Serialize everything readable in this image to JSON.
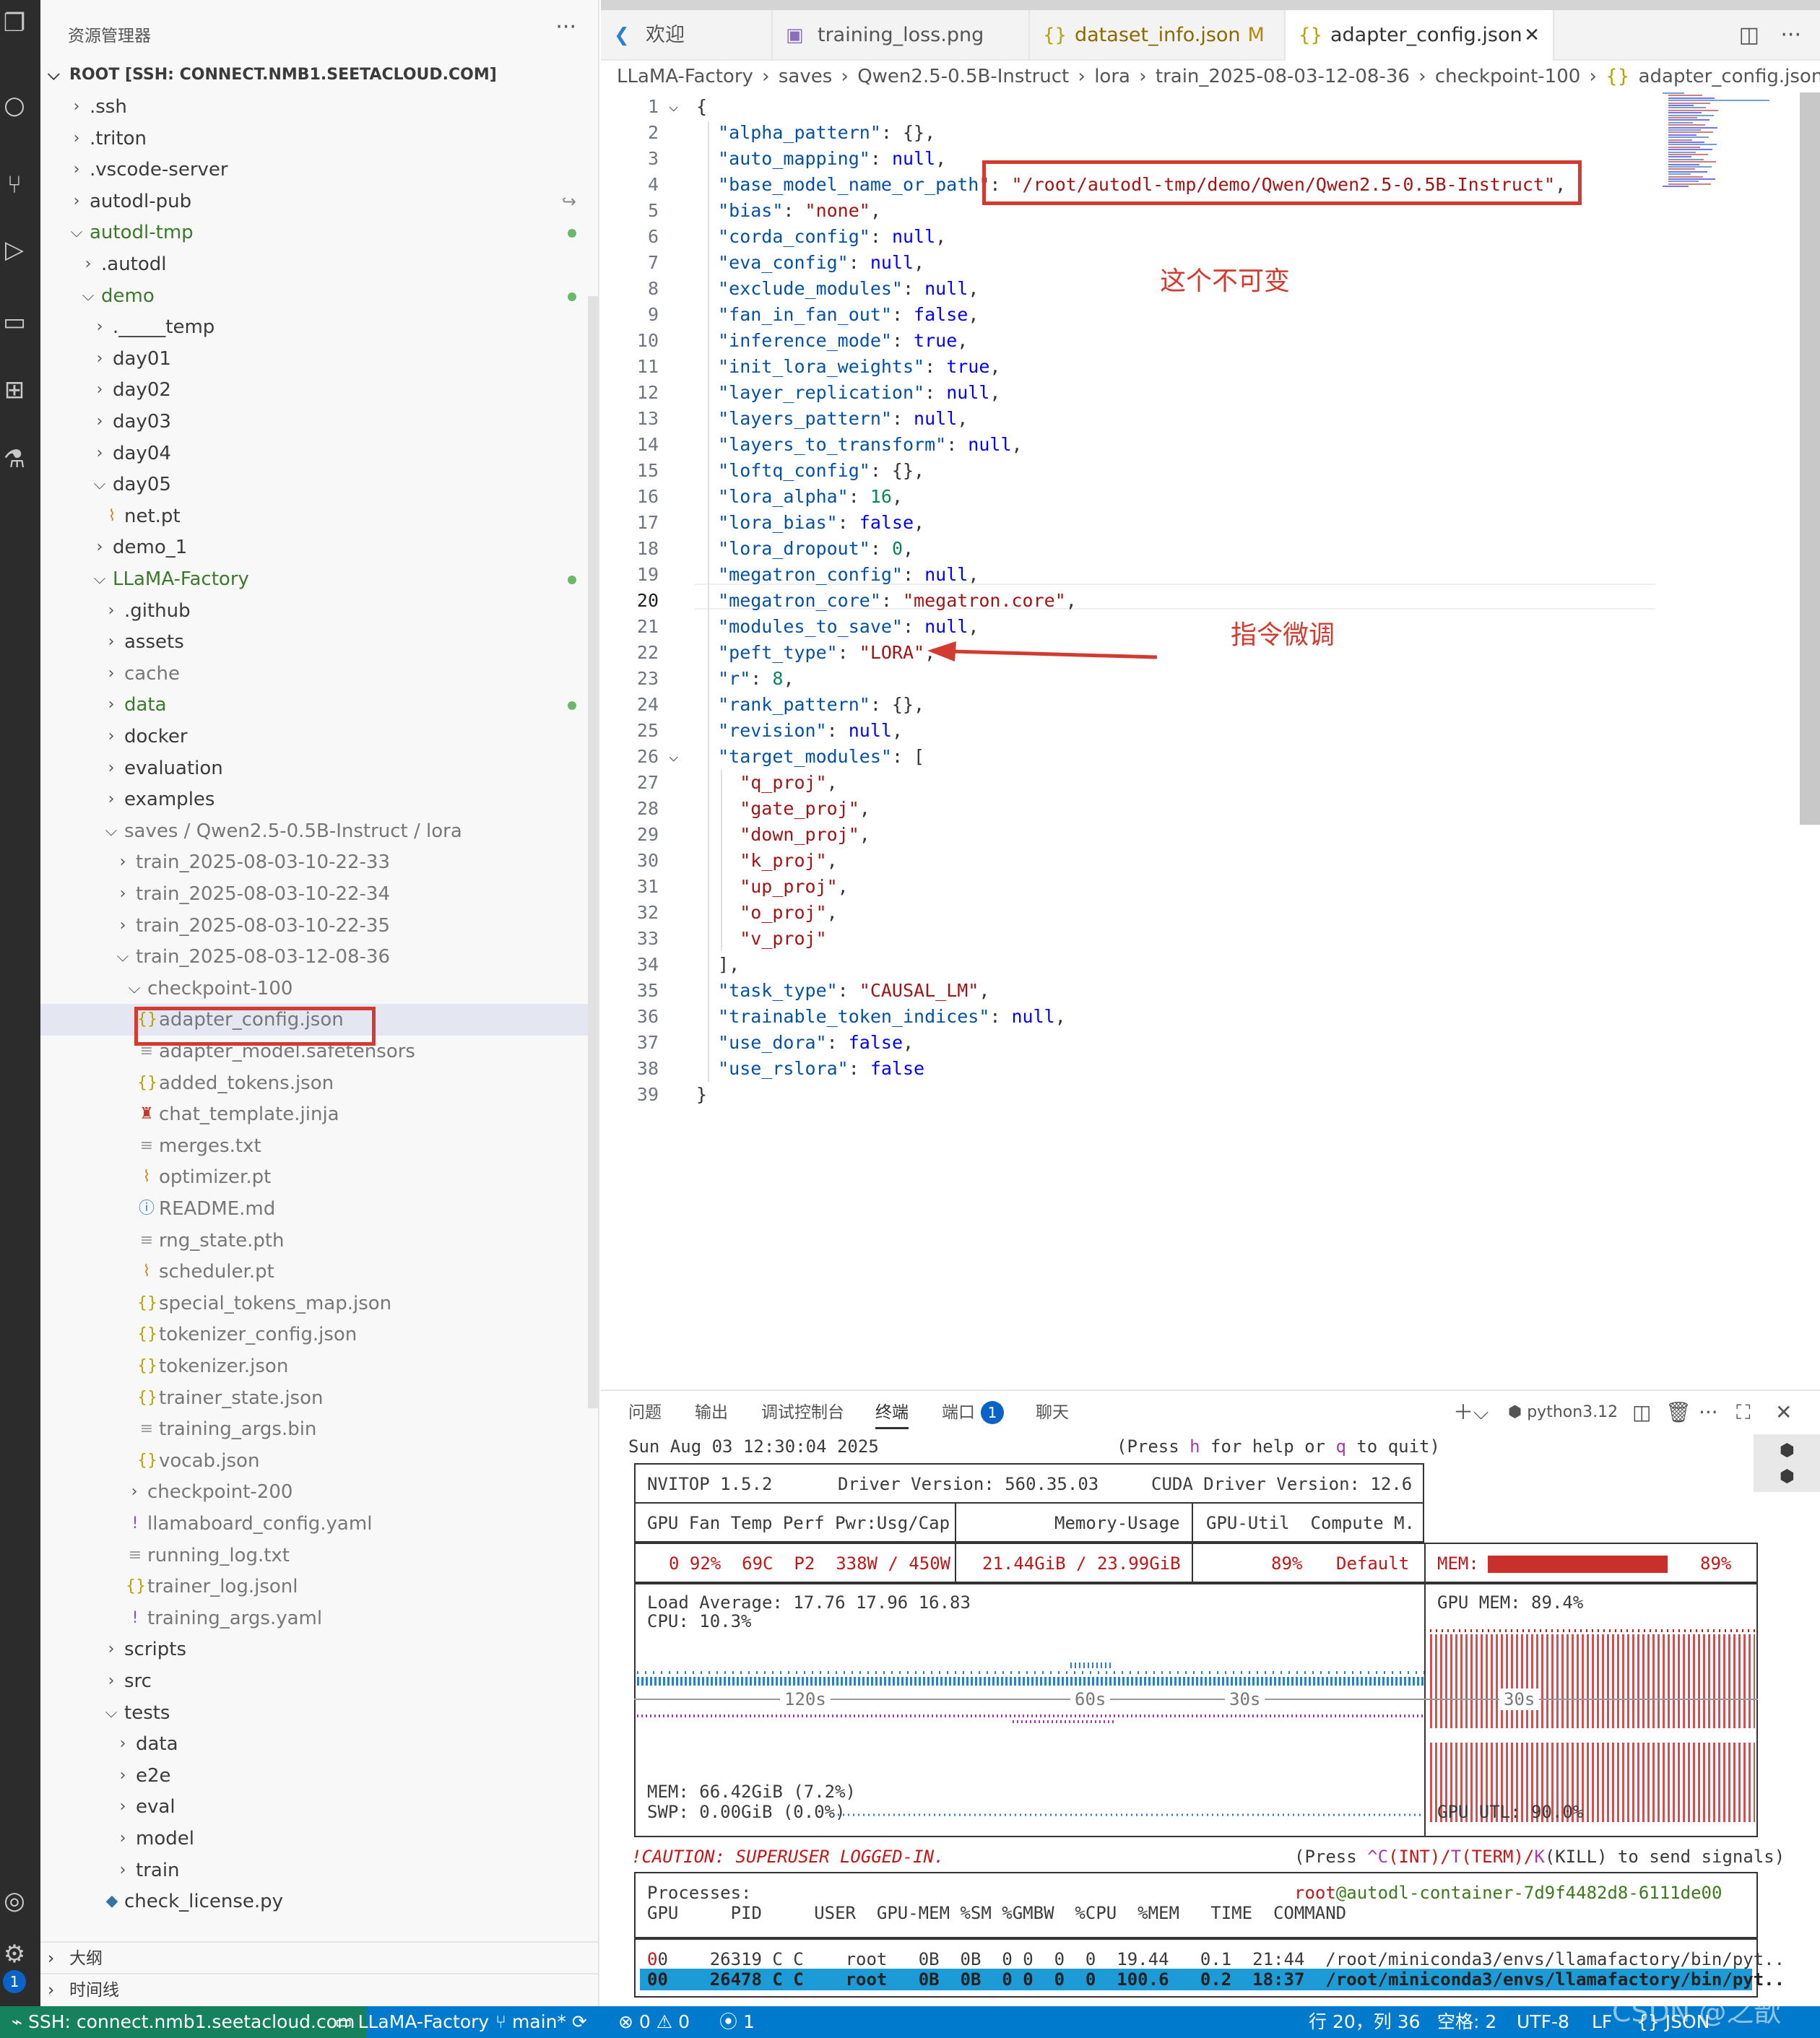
{
  "sidebar": {
    "title": "资源管理器",
    "root": "ROOT [SSH: CONNECT.NMB1.SEETACLOUD.COM]",
    "items": [
      {
        "label": ".ssh",
        "depth": 0,
        "type": "folder-closed"
      },
      {
        "label": ".triton",
        "depth": 0,
        "type": "folder-closed"
      },
      {
        "label": ".vscode-server",
        "depth": 0,
        "type": "folder-closed"
      },
      {
        "label": "autodl-pub",
        "depth": 0,
        "type": "folder-closed",
        "badge": "link"
      },
      {
        "label": "autodl-tmp",
        "depth": 0,
        "type": "folder-open",
        "status": "modified"
      },
      {
        "label": ".autodl",
        "depth": 1,
        "type": "folder-closed"
      },
      {
        "label": "demo",
        "depth": 1,
        "type": "folder-open",
        "status": "modified"
      },
      {
        "label": "._____temp",
        "depth": 2,
        "type": "folder-closed"
      },
      {
        "label": "day01",
        "depth": 2,
        "type": "folder-closed"
      },
      {
        "label": "day02",
        "depth": 2,
        "type": "folder-closed"
      },
      {
        "label": "day03",
        "depth": 2,
        "type": "folder-closed"
      },
      {
        "label": "day04",
        "depth": 2,
        "type": "folder-closed"
      },
      {
        "label": "day05",
        "depth": 2,
        "type": "folder-open"
      },
      {
        "label": "net.pt",
        "depth": 3,
        "type": "file-rss"
      },
      {
        "label": "demo_1",
        "depth": 2,
        "type": "folder-closed"
      },
      {
        "label": "LLaMA-Factory",
        "depth": 2,
        "type": "folder-open",
        "status": "modified"
      },
      {
        "label": ".github",
        "depth": 3,
        "type": "folder-closed"
      },
      {
        "label": "assets",
        "depth": 3,
        "type": "folder-closed"
      },
      {
        "label": "cache",
        "depth": 3,
        "type": "folder-closed",
        "dim": true
      },
      {
        "label": "data",
        "depth": 3,
        "type": "folder-closed",
        "status": "modified"
      },
      {
        "label": "docker",
        "depth": 3,
        "type": "folder-closed"
      },
      {
        "label": "evaluation",
        "depth": 3,
        "type": "folder-closed"
      },
      {
        "label": "examples",
        "depth": 3,
        "type": "folder-closed"
      },
      {
        "label": "saves / Qwen2.5-0.5B-Instruct / lora",
        "depth": 3,
        "type": "folder-open",
        "dim": true
      },
      {
        "label": "train_2025-08-03-10-22-33",
        "depth": 4,
        "type": "folder-closed",
        "dim": true
      },
      {
        "label": "train_2025-08-03-10-22-34",
        "depth": 4,
        "type": "folder-closed",
        "dim": true
      },
      {
        "label": "train_2025-08-03-10-22-35",
        "depth": 4,
        "type": "folder-closed",
        "dim": true
      },
      {
        "label": "train_2025-08-03-12-08-36",
        "depth": 4,
        "type": "folder-open",
        "dim": true
      },
      {
        "label": "checkpoint-100",
        "depth": 5,
        "type": "folder-open",
        "dim": true
      },
      {
        "label": "adapter_config.json",
        "depth": 6,
        "type": "file-json",
        "dim": true,
        "selected": true
      },
      {
        "label": "adapter_model.safetensors",
        "depth": 6,
        "type": "file-text",
        "dim": true
      },
      {
        "label": "added_tokens.json",
        "depth": 6,
        "type": "file-json",
        "dim": true
      },
      {
        "label": "chat_template.jinja",
        "depth": 6,
        "type": "file-jinja",
        "dim": true
      },
      {
        "label": "merges.txt",
        "depth": 6,
        "type": "file-text",
        "dim": true
      },
      {
        "label": "optimizer.pt",
        "depth": 6,
        "type": "file-rss",
        "dim": true
      },
      {
        "label": "README.md",
        "depth": 6,
        "type": "file-info",
        "dim": true
      },
      {
        "label": "rng_state.pth",
        "depth": 6,
        "type": "file-text",
        "dim": true
      },
      {
        "label": "scheduler.pt",
        "depth": 6,
        "type": "file-rss",
        "dim": true
      },
      {
        "label": "special_tokens_map.json",
        "depth": 6,
        "type": "file-json",
        "dim": true
      },
      {
        "label": "tokenizer_config.json",
        "depth": 6,
        "type": "file-json",
        "dim": true
      },
      {
        "label": "tokenizer.json",
        "depth": 6,
        "type": "file-json",
        "dim": true
      },
      {
        "label": "trainer_state.json",
        "depth": 6,
        "type": "file-json",
        "dim": true
      },
      {
        "label": "training_args.bin",
        "depth": 6,
        "type": "file-text",
        "dim": true
      },
      {
        "label": "vocab.json",
        "depth": 6,
        "type": "file-json",
        "dim": true
      },
      {
        "label": "checkpoint-200",
        "depth": 5,
        "type": "folder-closed",
        "dim": true
      },
      {
        "label": "llamaboard_config.yaml",
        "depth": 5,
        "type": "file-yaml",
        "dim": true
      },
      {
        "label": "running_log.txt",
        "depth": 5,
        "type": "file-text",
        "dim": true
      },
      {
        "label": "trainer_log.jsonl",
        "depth": 5,
        "type": "file-json",
        "dim": true
      },
      {
        "label": "training_args.yaml",
        "depth": 5,
        "type": "file-yaml",
        "dim": true
      },
      {
        "label": "scripts",
        "depth": 3,
        "type": "folder-closed"
      },
      {
        "label": "src",
        "depth": 3,
        "type": "folder-closed"
      },
      {
        "label": "tests",
        "depth": 3,
        "type": "folder-open"
      },
      {
        "label": "data",
        "depth": 4,
        "type": "folder-closed"
      },
      {
        "label": "e2e",
        "depth": 4,
        "type": "folder-closed"
      },
      {
        "label": "eval",
        "depth": 4,
        "type": "folder-closed"
      },
      {
        "label": "model",
        "depth": 4,
        "type": "folder-closed"
      },
      {
        "label": "train",
        "depth": 4,
        "type": "folder-closed"
      },
      {
        "label": "check_license.py",
        "depth": 3,
        "type": "file-python"
      }
    ],
    "outline": "大纲",
    "timeline": "时间线"
  },
  "tabs": [
    {
      "label": "欢迎",
      "icon": "vscode-icon"
    },
    {
      "label": "training_loss.png",
      "icon": "image-icon"
    },
    {
      "label": "dataset_info.json",
      "icon": "json-icon",
      "modified": "M"
    },
    {
      "label": "adapter_config.json",
      "icon": "json-icon",
      "active": true
    }
  ],
  "breadcrumb": [
    "LLaMA-Factory",
    "saves",
    "Qwen2.5-0.5B-Instruct",
    "lora",
    "train_2025-08-03-12-08-36",
    "checkpoint-100",
    "adapter_config.json",
    "..."
  ],
  "code": {
    "current_line": 20,
    "lines": [
      [
        [
          "pun",
          "{"
        ]
      ],
      [
        [
          "key",
          "  \"alpha_pattern\""
        ],
        [
          "pun",
          ": {},"
        ]
      ],
      [
        [
          "key",
          "  \"auto_mapping\""
        ],
        [
          "pun",
          ": "
        ],
        [
          "kw",
          "null"
        ],
        [
          "pun",
          ","
        ]
      ],
      [
        [
          "key",
          "  \"base_model_name_or_path\""
        ],
        [
          "pun",
          ": "
        ],
        [
          "str",
          "\"/root/autodl-tmp/demo/Qwen/Qwen2.5-0.5B-Instruct\""
        ],
        [
          "pun",
          ","
        ]
      ],
      [
        [
          "key",
          "  \"bias\""
        ],
        [
          "pun",
          ": "
        ],
        [
          "str",
          "\"none\""
        ],
        [
          "pun",
          ","
        ]
      ],
      [
        [
          "key",
          "  \"corda_config\""
        ],
        [
          "pun",
          ": "
        ],
        [
          "kw",
          "null"
        ],
        [
          "pun",
          ","
        ]
      ],
      [
        [
          "key",
          "  \"eva_config\""
        ],
        [
          "pun",
          ": "
        ],
        [
          "kw",
          "null"
        ],
        [
          "pun",
          ","
        ]
      ],
      [
        [
          "key",
          "  \"exclude_modules\""
        ],
        [
          "pun",
          ": "
        ],
        [
          "kw",
          "null"
        ],
        [
          "pun",
          ","
        ]
      ],
      [
        [
          "key",
          "  \"fan_in_fan_out\""
        ],
        [
          "pun",
          ": "
        ],
        [
          "kw",
          "false"
        ],
        [
          "pun",
          ","
        ]
      ],
      [
        [
          "key",
          "  \"inference_mode\""
        ],
        [
          "pun",
          ": "
        ],
        [
          "kw",
          "true"
        ],
        [
          "pun",
          ","
        ]
      ],
      [
        [
          "key",
          "  \"init_lora_weights\""
        ],
        [
          "pun",
          ": "
        ],
        [
          "kw",
          "true"
        ],
        [
          "pun",
          ","
        ]
      ],
      [
        [
          "key",
          "  \"layer_replication\""
        ],
        [
          "pun",
          ": "
        ],
        [
          "kw",
          "null"
        ],
        [
          "pun",
          ","
        ]
      ],
      [
        [
          "key",
          "  \"layers_pattern\""
        ],
        [
          "pun",
          ": "
        ],
        [
          "kw",
          "null"
        ],
        [
          "pun",
          ","
        ]
      ],
      [
        [
          "key",
          "  \"layers_to_transform\""
        ],
        [
          "pun",
          ": "
        ],
        [
          "kw",
          "null"
        ],
        [
          "pun",
          ","
        ]
      ],
      [
        [
          "key",
          "  \"loftq_config\""
        ],
        [
          "pun",
          ": {},"
        ]
      ],
      [
        [
          "key",
          "  \"lora_alpha\""
        ],
        [
          "pun",
          ": "
        ],
        [
          "num",
          "16"
        ],
        [
          "pun",
          ","
        ]
      ],
      [
        [
          "key",
          "  \"lora_bias\""
        ],
        [
          "pun",
          ": "
        ],
        [
          "kw",
          "false"
        ],
        [
          "pun",
          ","
        ]
      ],
      [
        [
          "key",
          "  \"lora_dropout\""
        ],
        [
          "pun",
          ": "
        ],
        [
          "num",
          "0"
        ],
        [
          "pun",
          ","
        ]
      ],
      [
        [
          "key",
          "  \"megatron_config\""
        ],
        [
          "pun",
          ": "
        ],
        [
          "kw",
          "null"
        ],
        [
          "pun",
          ","
        ]
      ],
      [
        [
          "key",
          "  \"megatron_core\""
        ],
        [
          "pun",
          ": "
        ],
        [
          "str",
          "\"megatron.core\""
        ],
        [
          "pun",
          ","
        ]
      ],
      [
        [
          "key",
          "  \"modules_to_save\""
        ],
        [
          "pun",
          ": "
        ],
        [
          "kw",
          "null"
        ],
        [
          "pun",
          ","
        ]
      ],
      [
        [
          "key",
          "  \"peft_type\""
        ],
        [
          "pun",
          ": "
        ],
        [
          "str",
          "\"LORA\""
        ],
        [
          "pun",
          ","
        ]
      ],
      [
        [
          "key",
          "  \"r\""
        ],
        [
          "pun",
          ": "
        ],
        [
          "num",
          "8"
        ],
        [
          "pun",
          ","
        ]
      ],
      [
        [
          "key",
          "  \"rank_pattern\""
        ],
        [
          "pun",
          ": {},"
        ]
      ],
      [
        [
          "key",
          "  \"revision\""
        ],
        [
          "pun",
          ": "
        ],
        [
          "kw",
          "null"
        ],
        [
          "pun",
          ","
        ]
      ],
      [
        [
          "key",
          "  \"target_modules\""
        ],
        [
          "pun",
          ": ["
        ]
      ],
      [
        [
          "str",
          "    \"q_proj\""
        ],
        [
          "pun",
          ","
        ]
      ],
      [
        [
          "str",
          "    \"gate_proj\""
        ],
        [
          "pun",
          ","
        ]
      ],
      [
        [
          "str",
          "    \"down_proj\""
        ],
        [
          "pun",
          ","
        ]
      ],
      [
        [
          "str",
          "    \"k_proj\""
        ],
        [
          "pun",
          ","
        ]
      ],
      [
        [
          "str",
          "    \"up_proj\""
        ],
        [
          "pun",
          ","
        ]
      ],
      [
        [
          "str",
          "    \"o_proj\""
        ],
        [
          "pun",
          ","
        ]
      ],
      [
        [
          "str",
          "    \"v_proj\""
        ]
      ],
      [
        [
          "pun",
          "  ],"
        ]
      ],
      [
        [
          "key",
          "  \"task_type\""
        ],
        [
          "pun",
          ": "
        ],
        [
          "str",
          "\"CAUSAL_LM\""
        ],
        [
          "pun",
          ","
        ]
      ],
      [
        [
          "key",
          "  \"trainable_token_indices\""
        ],
        [
          "pun",
          ": "
        ],
        [
          "kw",
          "null"
        ],
        [
          "pun",
          ","
        ]
      ],
      [
        [
          "key",
          "  \"use_dora\""
        ],
        [
          "pun",
          ": "
        ],
        [
          "kw",
          "false"
        ],
        [
          "pun",
          ","
        ]
      ],
      [
        [
          "key",
          "  \"use_rslora\""
        ],
        [
          "pun",
          ": "
        ],
        [
          "kw",
          "false"
        ]
      ],
      [
        [
          "pun",
          "}"
        ]
      ]
    ]
  },
  "annotations": {
    "note1": "这个不可变",
    "note2": "指令微调"
  },
  "panel": {
    "tabs": [
      "问题",
      "输出",
      "调试控制台",
      "终端",
      "端口",
      "聊天"
    ],
    "active_tab": "终端",
    "port_count": "1",
    "shell": "python3.12"
  },
  "terminal": {
    "datetime": "Sun Aug 03 12:30:04 2025",
    "help_pre": "(Press ",
    "help_h": "h",
    "help_mid": " for help or ",
    "help_q": "q",
    "help_post": " to quit)",
    "nvitop": "NVITOP 1.5.2",
    "driver": "Driver Version: 560.35.03",
    "cuda": "CUDA Driver Version: 12.6",
    "hdr_gpu": "GPU Fan Temp Perf Pwr:Usg/Cap",
    "hdr_mem": "Memory-Usage",
    "hdr_util": "GPU-Util  Compute M.",
    "gpu_row": "0 92%  69C  P2  338W / 450W",
    "gpu_mem": "21.44GiB / 23.99GiB",
    "gpu_util": "89%",
    "gpu_mode": "Default",
    "mem_label": "MEM:",
    "mem_pct": "89%",
    "mem_fraction": 0.89,
    "load": "Load Average: 17.76 17.96 16.83",
    "cpu": "CPU: 10.3%",
    "gpu_mem_pct": "GPU MEM: 89.4%",
    "t120": "120s",
    "t60": "60s",
    "t30a": "30s",
    "t30b": "30s",
    "mem_host": "MEM: 66.42GiB (7.2%)",
    "swp": "SWP: 0.00GiB (0.0%)",
    "gpu_utl": "GPU UTL: 90.0%",
    "caution": "!CAUTION: SUPERUSER LOGGED-IN.",
    "signals_pre": "(Press ",
    "sig_c": "^C",
    "sig_int": "(INT)/",
    "sig_t": "T",
    "sig_term": "(TERM)/",
    "sig_k": "K",
    "sig_kill": "(KILL) to send signals)",
    "processes": "Processes:",
    "host_user": "root",
    "host_name": "@autodl-container-7d9f4482d8-6111de00",
    "proc_hdr": "GPU     PID     USER  GPU-MEM %SM %GMBW  %CPU  %MEM   TIME  COMMAND",
    "procs": [
      {
        "gpu": "0",
        "pid": "26319 C",
        "user": "root",
        "mem": "0B",
        "sm": "0",
        "gmbw": "0",
        "cpu": "19.4",
        "pmem": "0.1",
        "time": "21:44",
        "cmd": "/root/miniconda3/envs/llamafactory/bin/pyt.."
      },
      {
        "gpu": "0",
        "pid": "26478 C",
        "user": "root",
        "mem": "0B",
        "sm": "0",
        "gmbw": "0",
        "cpu": "100.6",
        "pmem": "0.2",
        "time": "18:37",
        "cmd": "/root/miniconda3/envs/llamafactory/bin/pyt.."
      }
    ]
  },
  "status": {
    "remote": "SSH: connect.nmb1.seetacloud.com",
    "workspace": "LLaMA-Factory",
    "branch": "main*",
    "errors": "0",
    "warnings": "0",
    "ports": "1",
    "position": "行 20，列 36",
    "spaces": "空格: 2",
    "encoding": "UTF-8",
    "eol": "LF",
    "language": "JSON",
    "watermark": "CSDN @之歆"
  },
  "colors": {
    "accent": "#007acc",
    "remote": "#16825d",
    "annotation": "#d23b2f",
    "key": "#0451a5",
    "string": "#a31515",
    "keyword": "#0000ff",
    "number": "#098658"
  }
}
